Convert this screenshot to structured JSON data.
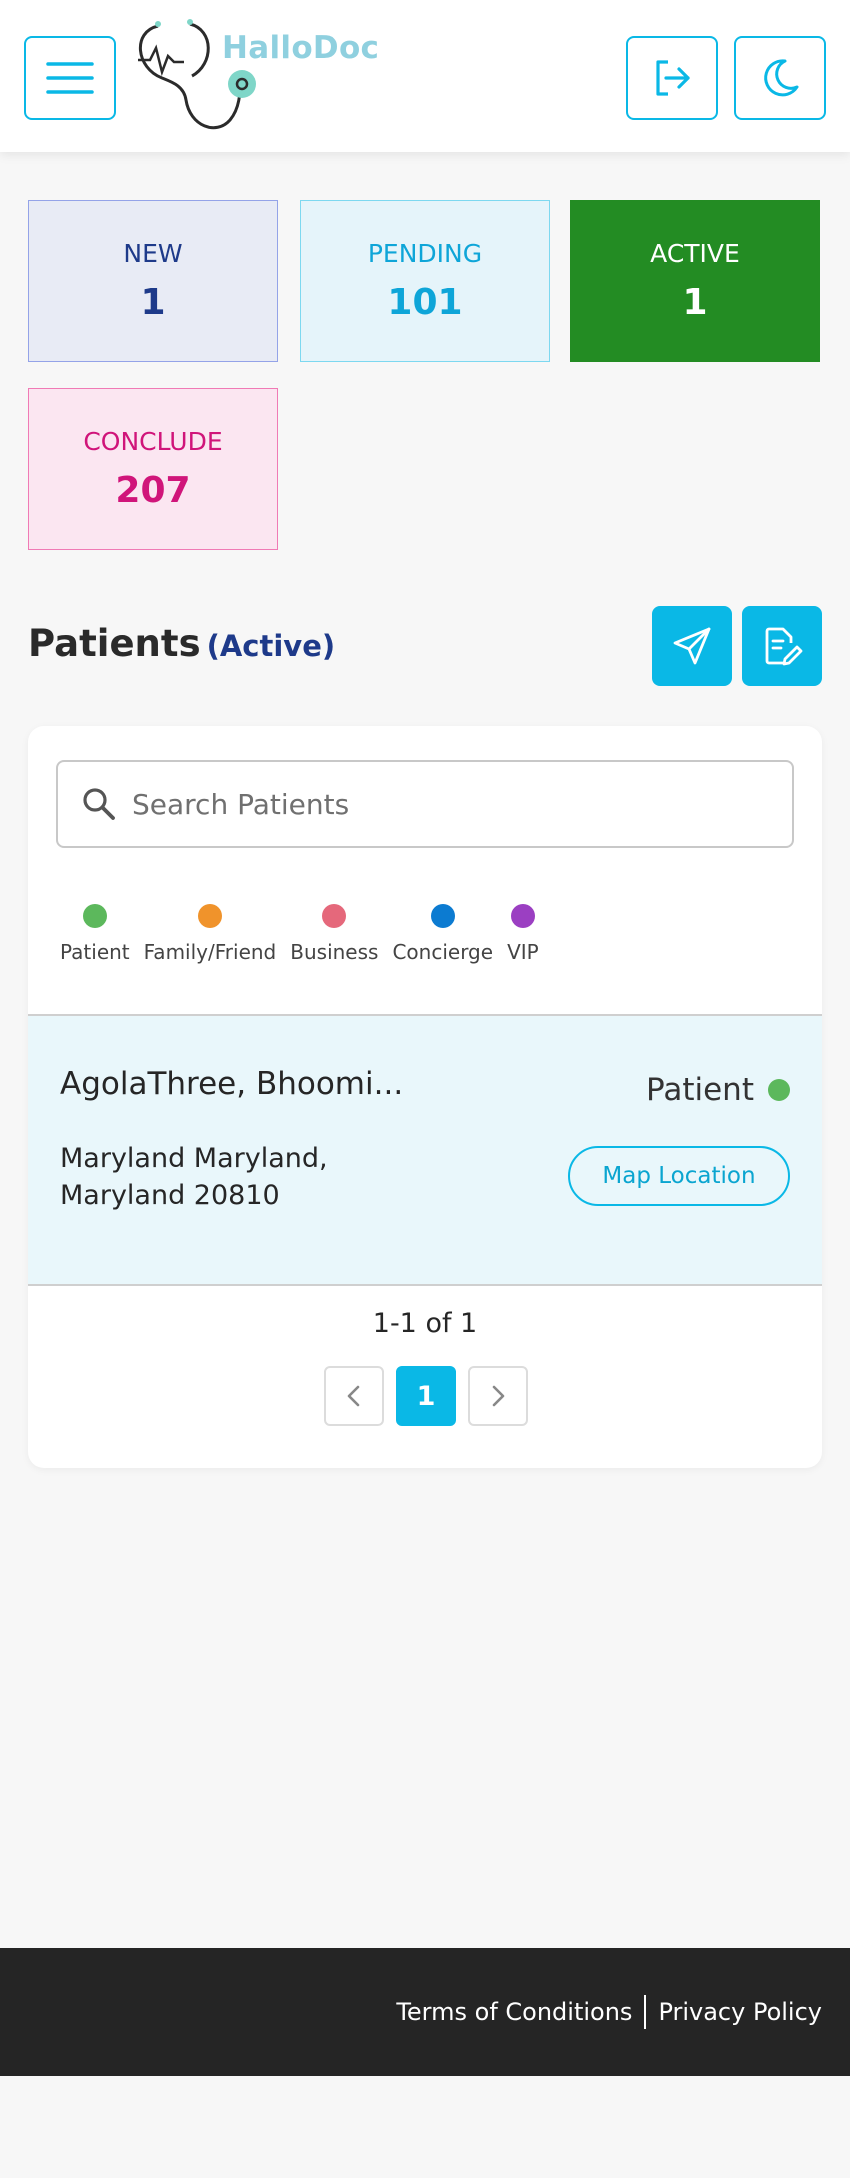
{
  "header": {
    "brand": "HalloDoc",
    "icons": {
      "menu": "hamburger-menu-icon",
      "logout": "logout-icon",
      "theme": "moon-icon"
    }
  },
  "status_cards": {
    "new": {
      "label": "NEW",
      "count": "1"
    },
    "pending": {
      "label": "PENDING",
      "count": "101"
    },
    "active": {
      "label": "ACTIVE",
      "count": "1"
    },
    "conclude": {
      "label": "CONCLUDE",
      "count": "207"
    }
  },
  "patients": {
    "title": "Patients",
    "status": "(Active)"
  },
  "search": {
    "placeholder": "Search Patients",
    "value": ""
  },
  "legend": [
    {
      "label": "Patient",
      "color": "#5cb85c"
    },
    {
      "label": "Family/Friend",
      "color": "#f0932b"
    },
    {
      "label": "Business",
      "color": "#e5687b"
    },
    {
      "label": "Concierge",
      "color": "#0c7bd1"
    },
    {
      "label": "VIP",
      "color": "#9b3fc2"
    }
  ],
  "rows": [
    {
      "name": "AgolaThree, Bhoomi...",
      "address": "Maryland Maryland, Maryland 20810",
      "type": "Patient",
      "type_color": "#5cb85c",
      "map_label": "Map Location"
    }
  ],
  "pagination": {
    "summary": "1-1 of 1",
    "current": "1",
    "prev": "‹",
    "next": "›"
  },
  "footer": {
    "terms": "Terms of Conditions",
    "privacy": "Privacy Policy"
  },
  "colors": {
    "accent": "#0ab8e6",
    "active_card": "#238c23",
    "conclude_text": "#d0157a",
    "new_text": "#1e3a8a"
  }
}
